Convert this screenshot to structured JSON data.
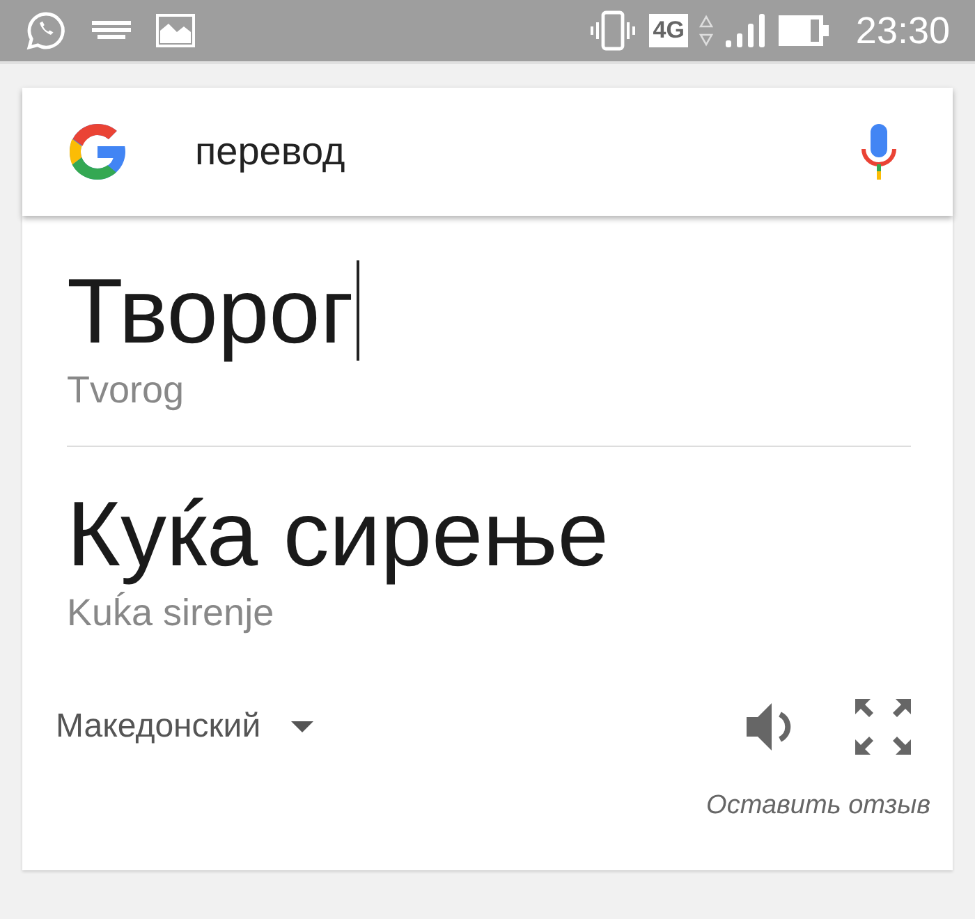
{
  "status_bar": {
    "network": "4G",
    "time": "23:30"
  },
  "search": {
    "value": "перевод"
  },
  "translation": {
    "source": {
      "text": "Творог",
      "transliteration": "Tvorog"
    },
    "target": {
      "text": "Куќа сирење",
      "transliteration": "Kuḱa sirenje"
    },
    "language": "Македонский",
    "feedback_link": "Оставить отзыв"
  }
}
